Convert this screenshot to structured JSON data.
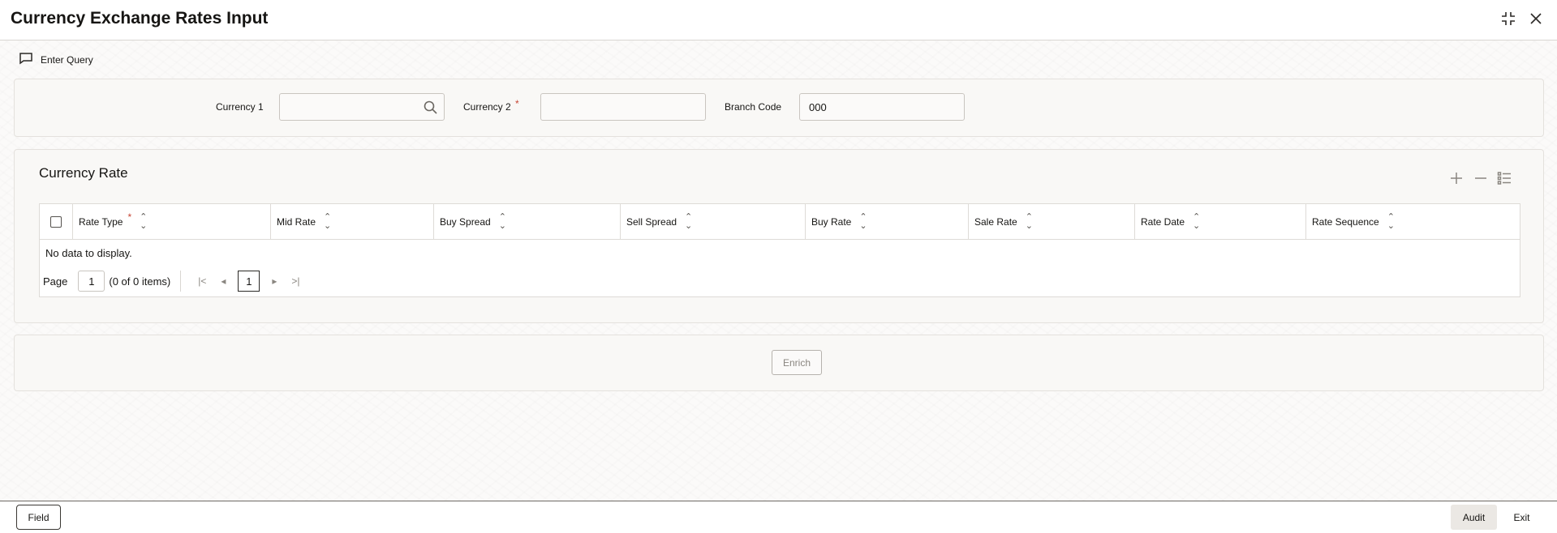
{
  "window": {
    "title": "Currency Exchange Rates Input",
    "icons": [
      "collapse-icon",
      "close-icon"
    ]
  },
  "toolbar": {
    "enter_query_label": "Enter Query",
    "enter_query_icon": "chat-bubble-icon"
  },
  "query": {
    "currency1_label": "Currency 1",
    "currency1_value": "",
    "currency2_label": "Currency 2",
    "currency2_required": "*",
    "currency2_value": "",
    "branch_code_label": "Branch Code",
    "branch_code_value": "000"
  },
  "currency_rate": {
    "title": "Currency Rate",
    "actions": [
      "add-icon",
      "remove-icon",
      "list-icon"
    ],
    "columns": [
      {
        "label": "Rate Type",
        "required": "*"
      },
      {
        "label": "Mid Rate"
      },
      {
        "label": "Buy Spread"
      },
      {
        "label": "Sell Spread"
      },
      {
        "label": "Buy Rate"
      },
      {
        "label": "Sale Rate"
      },
      {
        "label": "Rate Date"
      },
      {
        "label": "Rate Sequence"
      }
    ],
    "empty_text": "No data to display.",
    "pager": {
      "page_label": "Page",
      "page_value": "1",
      "items_text": "(0 of 0 items)",
      "current_page": "1"
    }
  },
  "enrich_label": "Enrich",
  "footer": {
    "field_label": "Field",
    "audit_label": "Audit",
    "exit_label": "Exit"
  },
  "colors": {
    "required": "#c74634",
    "panel_bg": "#f9f8f6",
    "text": "#161513"
  }
}
